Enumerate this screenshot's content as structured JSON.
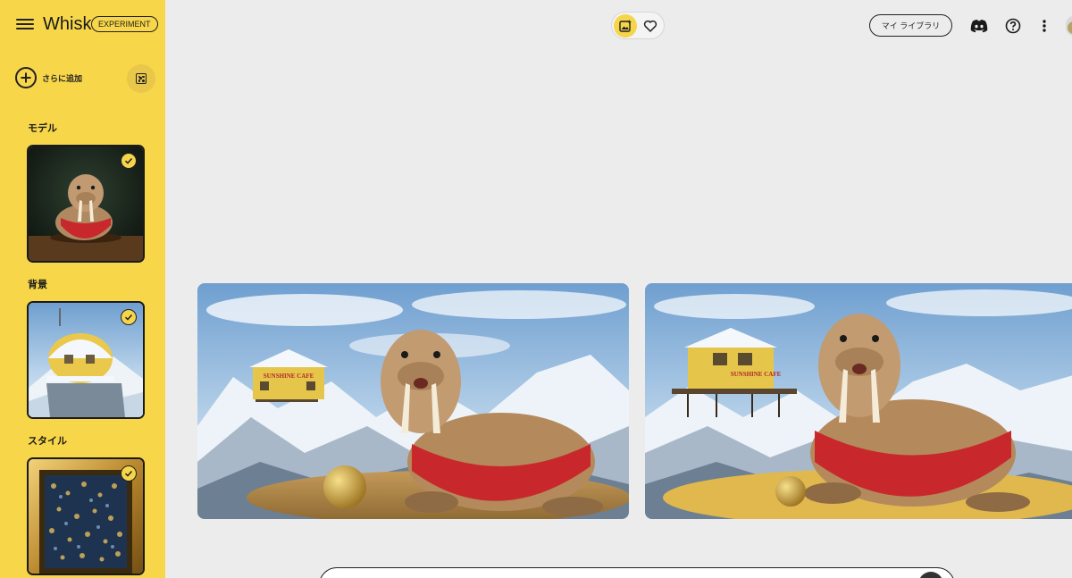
{
  "app": {
    "title": "Whisk",
    "badge": "EXPERIMENT"
  },
  "sidebar": {
    "add_label": "さらに追加",
    "sections": [
      {
        "title": "モデル",
        "selected": true
      },
      {
        "title": "背景",
        "selected": true
      },
      {
        "title": "スタイル",
        "selected": true
      }
    ]
  },
  "header": {
    "library_label": "マイ ライブラリ"
  },
  "results": {
    "cards": [
      {
        "cafe_sign": "SUNSHINE CAFE"
      },
      {
        "cafe_sign": "SUNSHINE CAFE"
      }
    ]
  },
  "colors": {
    "sidebar": "#f7d64a",
    "accent": "#f5d54a",
    "canvas": "#ececec"
  },
  "icons": [
    "menu-icon",
    "add-circle-icon",
    "dice-icon",
    "image-sparkle-icon",
    "heart-icon",
    "discord-icon",
    "help-icon",
    "more-vert-icon",
    "check-icon",
    "send-icon"
  ]
}
